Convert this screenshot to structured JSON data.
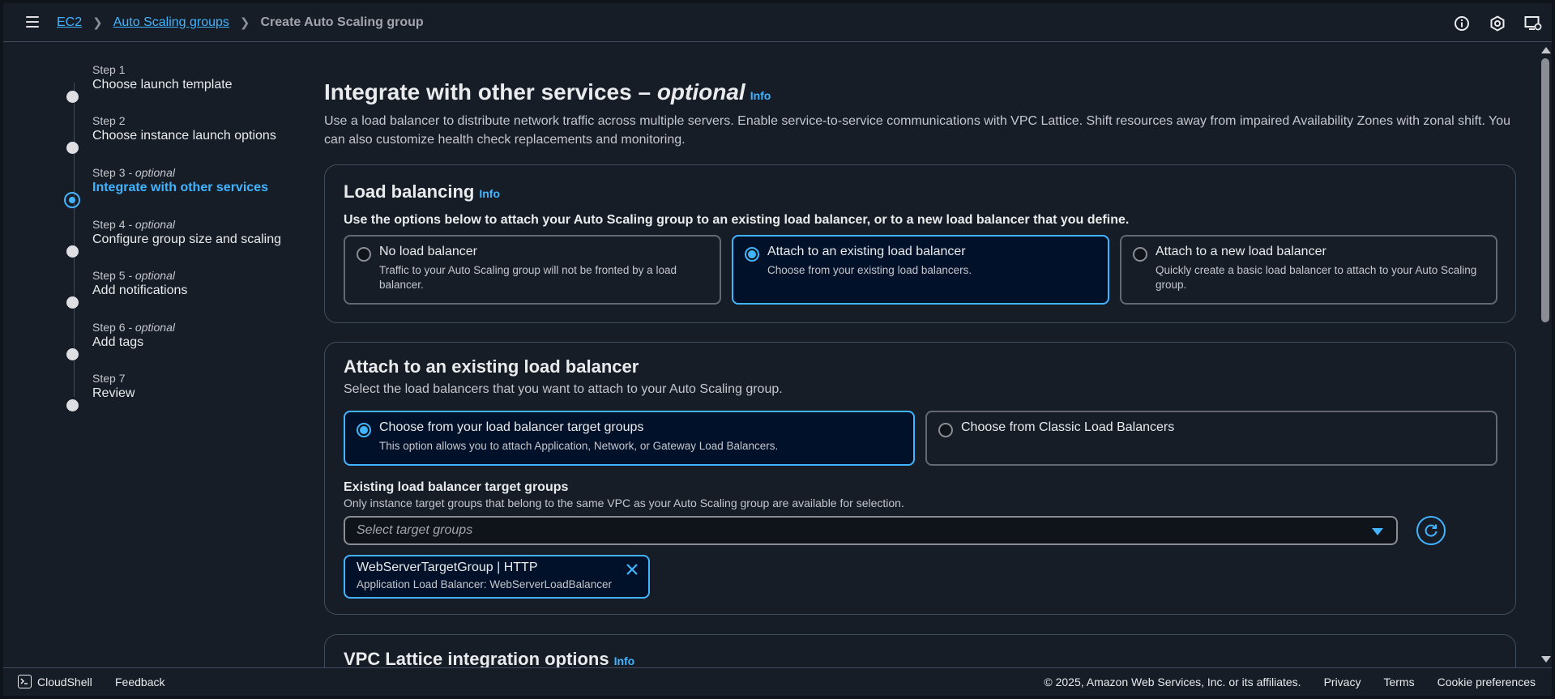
{
  "breadcrumb": {
    "items": [
      "EC2",
      "Auto Scaling groups"
    ],
    "current": "Create Auto Scaling group"
  },
  "header_icons": [
    "info-circle-icon",
    "notifications-icon",
    "settings-icon"
  ],
  "steps": [
    {
      "num": "Step 1",
      "optional": "",
      "title": "Choose launch template"
    },
    {
      "num": "Step 2",
      "optional": "",
      "title": "Choose instance launch options"
    },
    {
      "num": "Step 3",
      "optional": " - optional",
      "title": "Integrate with other services"
    },
    {
      "num": "Step 4",
      "optional": " - optional",
      "title": "Configure group size and scaling"
    },
    {
      "num": "Step 5",
      "optional": " - optional",
      "title": "Add notifications"
    },
    {
      "num": "Step 6",
      "optional": " - optional",
      "title": "Add tags"
    },
    {
      "num": "Step 7",
      "optional": "",
      "title": "Review"
    }
  ],
  "page": {
    "title": "Integrate with other services – ",
    "title_optional": "optional",
    "info": "Info",
    "description": "Use a load balancer to distribute network traffic across multiple servers. Enable service-to-service communications with VPC Lattice. Shift resources away from impaired Availability Zones with zonal shift. You can also customize health check replacements and monitoring."
  },
  "load_balancing": {
    "title": "Load balancing",
    "info": "Info",
    "instruction": "Use the options below to attach your Auto Scaling group to an existing load balancer, or to a new load balancer that you define.",
    "options": [
      {
        "label": "No load balancer",
        "desc": "Traffic to your Auto Scaling group will not be fronted by a load balancer."
      },
      {
        "label": "Attach to an existing load balancer",
        "desc": "Choose from your existing load balancers."
      },
      {
        "label": "Attach to a new load balancer",
        "desc": "Quickly create a basic load balancer to attach to your Auto Scaling group."
      }
    ]
  },
  "existing_lb": {
    "title": "Attach to an existing load balancer",
    "subtitle": "Select the load balancers that you want to attach to your Auto Scaling group.",
    "options": [
      {
        "label": "Choose from your load balancer target groups",
        "desc": "This option allows you to attach Application, Network, or Gateway Load Balancers."
      },
      {
        "label": "Choose from Classic Load Balancers",
        "desc": ""
      }
    ],
    "field_label": "Existing load balancer target groups",
    "field_hint": "Only instance target groups that belong to the same VPC as your Auto Scaling group are available for selection.",
    "select_placeholder": "Select target groups",
    "token": {
      "title": "WebServerTargetGroup | HTTP",
      "subtitle": "Application Load Balancer: WebServerLoadBalancer"
    }
  },
  "vpc_lattice": {
    "title": "VPC Lattice integration options",
    "info": "Info"
  },
  "footer": {
    "cloudshell": "CloudShell",
    "feedback": "Feedback",
    "copyright": "© 2025, Amazon Web Services, Inc. or its affiliates.",
    "links": [
      "Privacy",
      "Terms",
      "Cookie preferences"
    ]
  },
  "colors": {
    "accent": "#42b4ff",
    "background": "#161d26",
    "selected_tile": "#001129",
    "border": "#414d5c"
  }
}
